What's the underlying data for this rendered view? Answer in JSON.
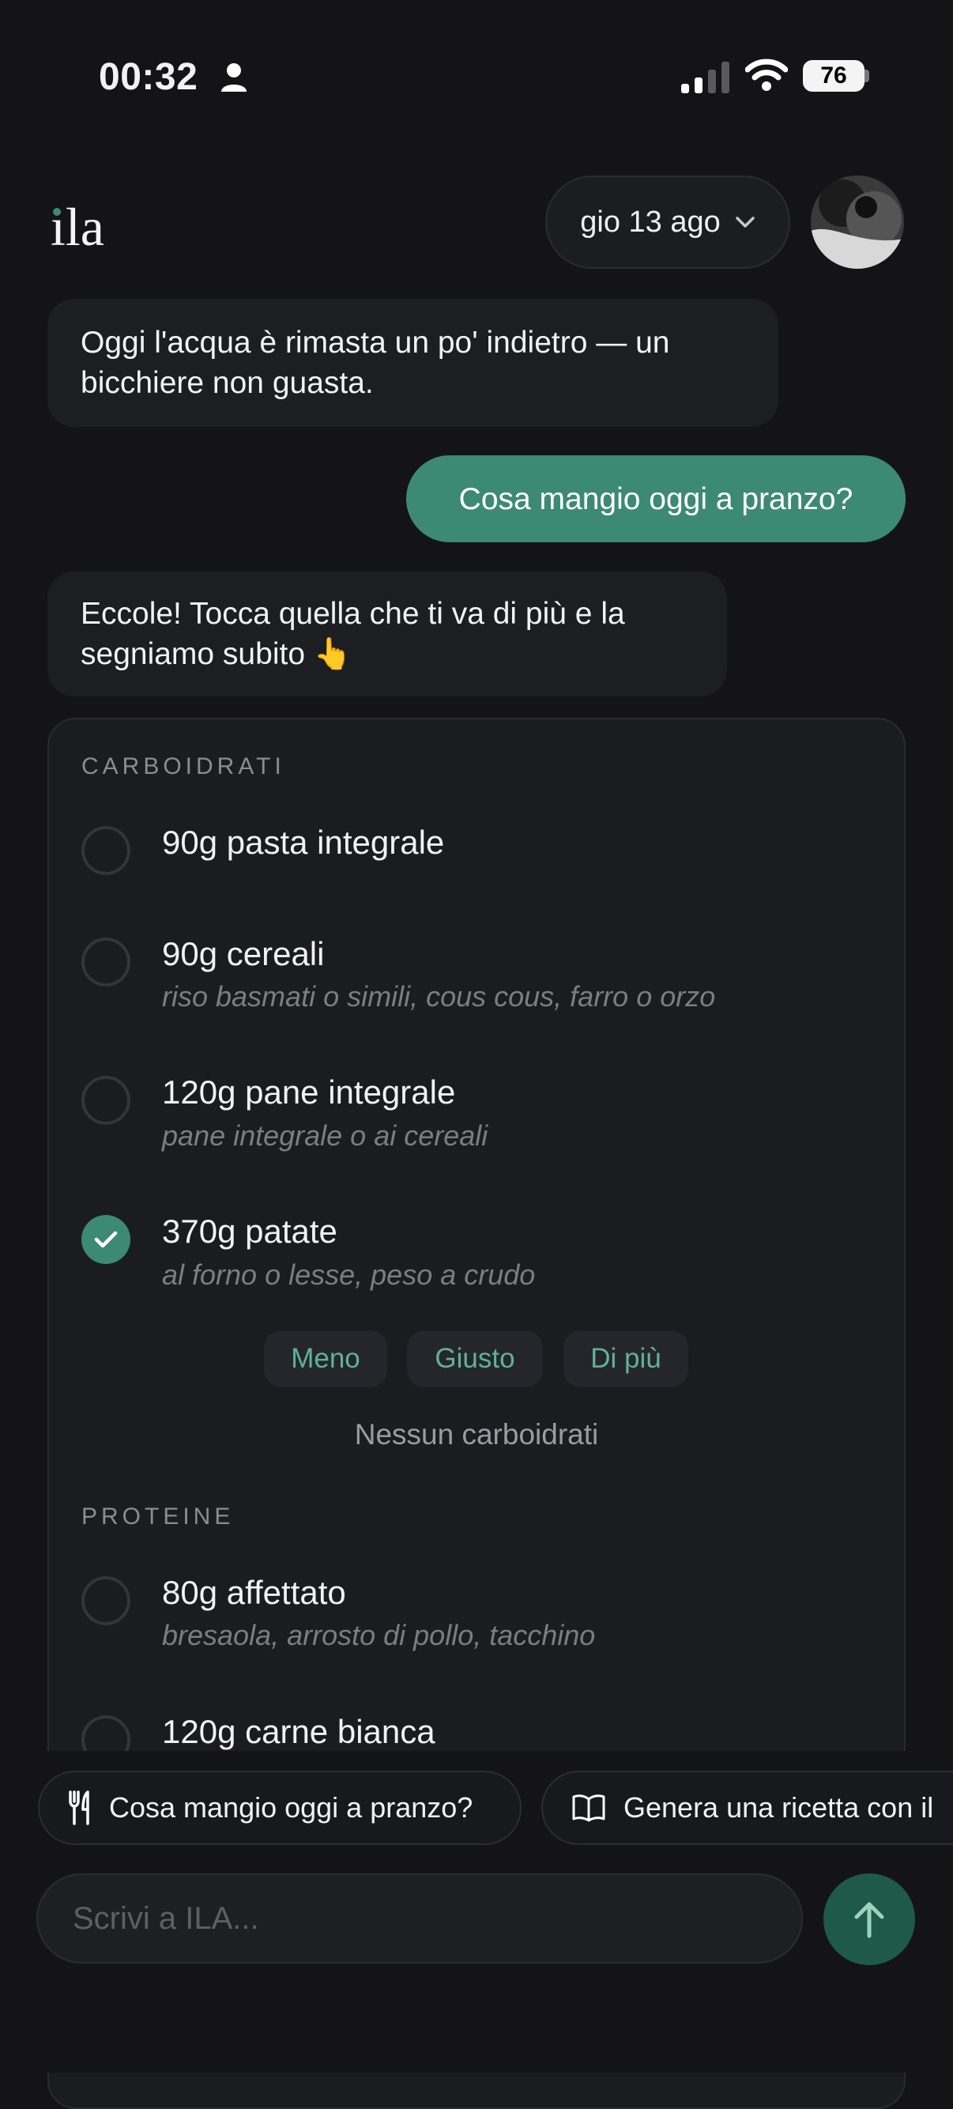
{
  "status_bar": {
    "time": "00:32",
    "battery": "76"
  },
  "header": {
    "logo": "ila",
    "date": "gio 13 ago"
  },
  "messages": [
    {
      "role": "assistant",
      "text": "Oggi l'acqua è rimasta un po' indietro — un bicchiere non guasta."
    },
    {
      "role": "user",
      "text": "Cosa mangio oggi a pranzo?"
    },
    {
      "role": "assistant",
      "text": "Eccole! Tocca quella che ti va di più e la segniamo subito 👆"
    }
  ],
  "meal_card": {
    "sections": [
      {
        "label": "CARBOIDRATI",
        "options": [
          {
            "title": "90g pasta integrale",
            "subtitle": "",
            "selected": false
          },
          {
            "title": "90g cereali",
            "subtitle": "riso basmati o simili, cous cous, farro o orzo",
            "selected": false
          },
          {
            "title": "120g pane integrale",
            "subtitle": "pane integrale o ai cereali",
            "selected": false
          },
          {
            "title": "370g patate",
            "subtitle": "al forno o lesse, peso a crudo",
            "selected": true
          }
        ],
        "portion_buttons": [
          "Meno",
          "Giusto",
          "Di più"
        ],
        "none_option": "Nessun carboidrati"
      },
      {
        "label": "PROTEINE",
        "options": [
          {
            "title": "80g affettato",
            "subtitle": "bresaola, arrosto di pollo, tacchino",
            "selected": false
          },
          {
            "title": "120g carne bianca",
            "subtitle": "",
            "selected": false
          }
        ]
      }
    ]
  },
  "suggestions": [
    {
      "icon": "fork-knife-icon",
      "label": "Cosa mangio oggi a pranzo?"
    },
    {
      "icon": "book-icon",
      "label": "Genera una ricetta con il"
    }
  ],
  "composer": {
    "placeholder": "Scrivi a ILA..."
  },
  "colors": {
    "accent": "#3d8a72",
    "background": "#141417",
    "surface": "#1b1c20"
  }
}
